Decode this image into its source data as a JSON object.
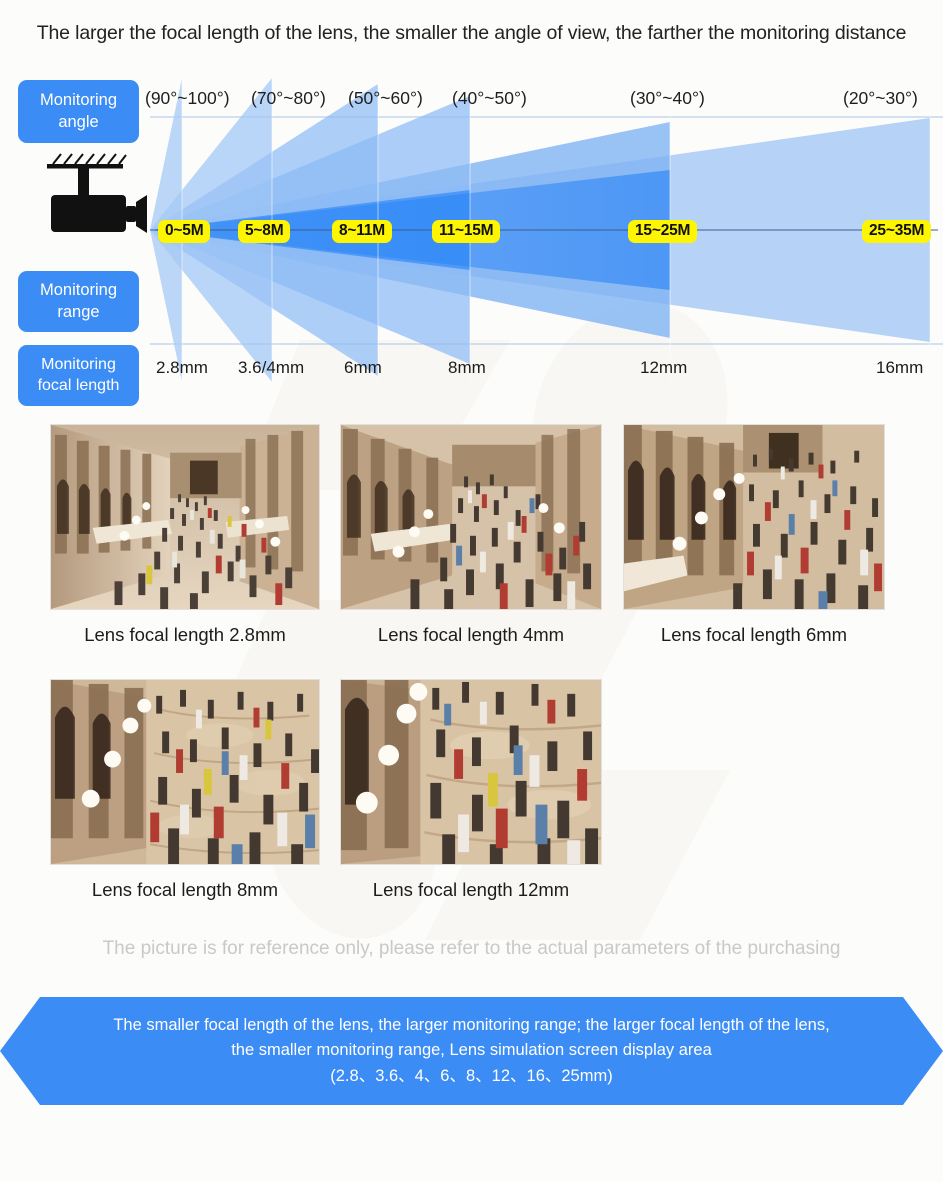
{
  "headline": "The larger the focal length of the lens, the smaller the angle of view, the farther the monitoring distance",
  "row_labels": {
    "angle_line1": "Monitoring",
    "angle_line2": "angle",
    "range_line1": "Monitoring",
    "range_line2": "range",
    "focal_line1": "Monitoring",
    "focal_line2": "focal length"
  },
  "colors": {
    "brand_blue": "#3b8cf5",
    "pill_yellow": "#fdf600",
    "beam_light": "#a8caf5",
    "beam_mid": "#6ca8f3",
    "beam_strong": "#2f86f7",
    "text_dark": "#1f1f1f",
    "disclaimer_gray": "#c9c9c9",
    "baseline": "#3d5e8c"
  },
  "chart_data": {
    "type": "diagram",
    "title": "Lens focal length vs monitoring angle and range",
    "xlabel": "Monitoring focal length",
    "ylabel": "Monitoring angle / range",
    "columns": [
      {
        "focal_length": "2.8mm",
        "angle": "(90°~100°)",
        "range": "0~5M",
        "angle_deg_min": 90,
        "angle_deg_max": 100,
        "range_m_min": 0,
        "range_m_max": 5
      },
      {
        "focal_length": "3.6/4mm",
        "angle": "(70°~80°)",
        "range": "5~8M",
        "angle_deg_min": 70,
        "angle_deg_max": 80,
        "range_m_min": 5,
        "range_m_max": 8
      },
      {
        "focal_length": "6mm",
        "angle": "(50°~60°)",
        "range": "8~11M",
        "angle_deg_min": 50,
        "angle_deg_max": 60,
        "range_m_min": 8,
        "range_m_max": 11
      },
      {
        "focal_length": "8mm",
        "angle": "(40°~50°)",
        "range": "11~15M",
        "angle_deg_min": 40,
        "angle_deg_max": 50,
        "range_m_min": 11,
        "range_m_max": 15
      },
      {
        "focal_length": "12mm",
        "angle": "(30°~40°)",
        "range": "15~25M",
        "angle_deg_min": 30,
        "angle_deg_max": 40,
        "range_m_min": 15,
        "range_m_max": 25
      },
      {
        "focal_length": "16mm",
        "angle": "(20°~30°)",
        "range": "25~35M",
        "angle_deg_min": 20,
        "angle_deg_max": 30,
        "range_m_min": 25,
        "range_m_max": 35
      }
    ]
  },
  "gallery": {
    "row1": [
      {
        "caption": "Lens focal length 2.8mm"
      },
      {
        "caption": "Lens focal length 4mm"
      },
      {
        "caption": "Lens focal length 6mm"
      }
    ],
    "row2": [
      {
        "caption": "Lens focal length 8mm"
      },
      {
        "caption": "Lens focal length 12mm"
      }
    ]
  },
  "disclaimer": "The picture is for reference only, please refer to the actual parameters of the purchasing",
  "banner": {
    "line1": "The smaller focal length of the lens, the larger monitoring range; the larger focal length of the lens,",
    "line2": "the smaller monitoring range, Lens simulation screen display area",
    "line3": "(2.8、3.6、4、6、8、12、16、25mm)"
  },
  "icons": {
    "camera": "cctv-camera-icon"
  }
}
